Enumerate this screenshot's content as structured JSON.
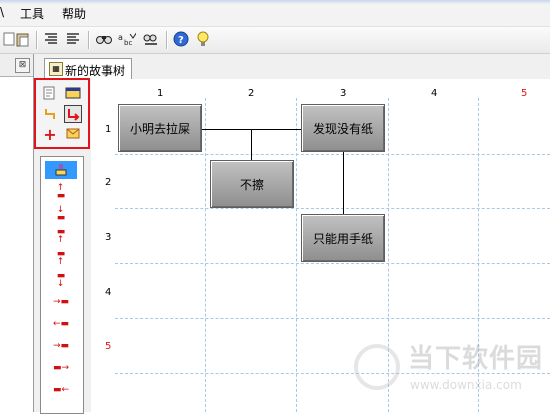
{
  "menu": {
    "left_fragment": "\\",
    "tools": "工具",
    "help": "帮助"
  },
  "toolbar": {
    "icons": [
      "page-icon",
      "clipboard-icon",
      "align-left-icon",
      "align-right-icon",
      "find-icon",
      "spellcheck-icon",
      "find-replace-icon",
      "help-icon",
      "tip-icon"
    ]
  },
  "left_pane": {
    "close_glyph": "⊠"
  },
  "tab": {
    "label": "新的故事树"
  },
  "grid": {
    "columns": [
      "1",
      "2",
      "3",
      "4",
      "5"
    ],
    "rows": [
      "1",
      "2",
      "3",
      "4",
      "5"
    ],
    "accent_color": "#e2141b"
  },
  "nodes": [
    {
      "label": "小明去拉屎"
    },
    {
      "label": "发现没有纸"
    },
    {
      "label": "不擦"
    },
    {
      "label": "只能用手纸"
    }
  ],
  "watermark": {
    "name": "当下软件园",
    "url": "www.downxia.com"
  }
}
